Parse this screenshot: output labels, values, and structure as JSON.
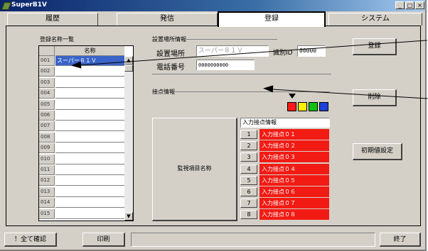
{
  "window": {
    "title": "SuperB1V"
  },
  "tabs": [
    {
      "label": "履歴"
    },
    {
      "label": "発信"
    },
    {
      "label": "登録"
    },
    {
      "label": "システム"
    }
  ],
  "list": {
    "section_label": "登録名称一覧",
    "column_header": "名称",
    "rows": [
      {
        "num": "001",
        "name": "スーパー８１Ｖ"
      },
      {
        "num": "002",
        "name": ""
      },
      {
        "num": "003",
        "name": ""
      },
      {
        "num": "004",
        "name": ""
      },
      {
        "num": "005",
        "name": ""
      },
      {
        "num": "006",
        "name": ""
      },
      {
        "num": "007",
        "name": ""
      },
      {
        "num": "008",
        "name": ""
      },
      {
        "num": "009",
        "name": ""
      },
      {
        "num": "010",
        "name": ""
      },
      {
        "num": "011",
        "name": ""
      },
      {
        "num": "012",
        "name": ""
      },
      {
        "num": "013",
        "name": ""
      },
      {
        "num": "014",
        "name": ""
      },
      {
        "num": "015",
        "name": ""
      }
    ]
  },
  "device_info": {
    "section_label": "設置場所情報",
    "location_label": "設置場所",
    "location_value": "スーパー８１Ｖ",
    "id_label": "識別ID",
    "id_value": "00000",
    "phone_label": "電話番号",
    "phone_value": "0000000000"
  },
  "contact_info": {
    "section_label": "接点情報",
    "color_swatches": [
      "#ff1a1a",
      "#ffee00",
      "#12c012",
      "#1f3fd8"
    ],
    "monitor_button": "監視項目名称",
    "input_header": "入力接点情報",
    "points": [
      {
        "num": "1",
        "label": "入力接点０１"
      },
      {
        "num": "2",
        "label": "入力接点０２"
      },
      {
        "num": "3",
        "label": "入力接点０３"
      },
      {
        "num": "4",
        "label": "入力接点０４"
      },
      {
        "num": "5",
        "label": "入力接点０５"
      },
      {
        "num": "6",
        "label": "入力接点０６"
      },
      {
        "num": "7",
        "label": "入力接点０７"
      },
      {
        "num": "8",
        "label": "入力接点０８"
      }
    ],
    "point_color": "#f21b14"
  },
  "buttons": {
    "register": "登録",
    "delete": "削除",
    "initial_setting": "初期値設定"
  },
  "footer": {
    "confirm_all": "！全て確認",
    "print": "印刷",
    "exit": "終了"
  }
}
